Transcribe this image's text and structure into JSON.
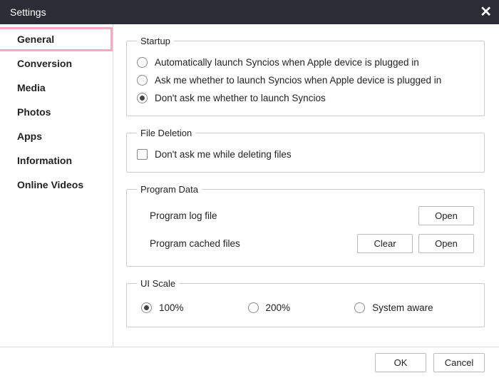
{
  "window": {
    "title": "Settings"
  },
  "sidebar": {
    "items": [
      {
        "label": "General"
      },
      {
        "label": "Conversion"
      },
      {
        "label": "Media"
      },
      {
        "label": "Photos"
      },
      {
        "label": "Apps"
      },
      {
        "label": "Information"
      },
      {
        "label": "Online Videos"
      }
    ]
  },
  "sections": {
    "startup": {
      "legend": "Startup",
      "opt_auto": "Automatically launch Syncios when Apple device is plugged in",
      "opt_ask": "Ask me whether to launch Syncios when Apple device is plugged in",
      "opt_dont": "Don't ask me whether to launch Syncios"
    },
    "file_deletion": {
      "legend": "File Deletion",
      "chk_label": "Don't ask me while deleting files"
    },
    "program_data": {
      "legend": "Program Data",
      "log_label": "Program log file",
      "cache_label": "Program cached files",
      "open": "Open",
      "clear": "Clear"
    },
    "ui_scale": {
      "legend": "UI Scale",
      "opt_100": "100%",
      "opt_200": "200%",
      "opt_system": "System aware"
    }
  },
  "footer": {
    "ok": "OK",
    "cancel": "Cancel"
  }
}
